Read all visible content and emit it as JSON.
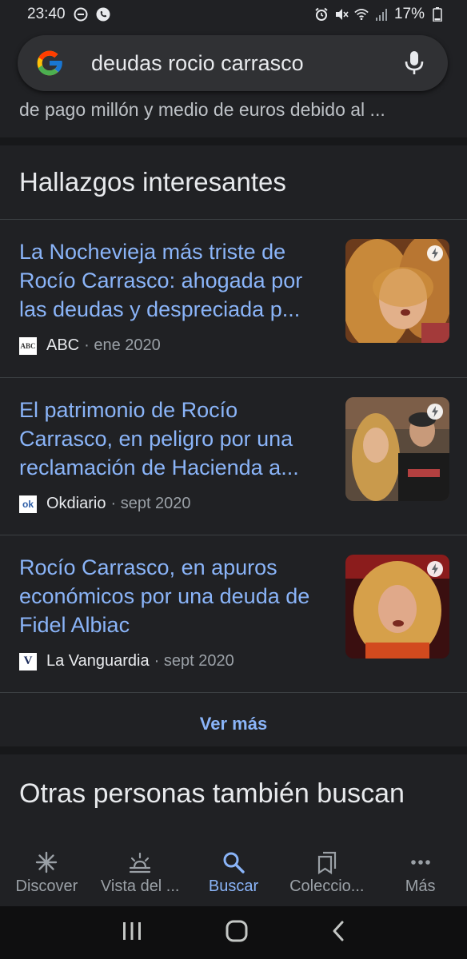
{
  "status_bar": {
    "time": "23:40",
    "battery": "17%"
  },
  "search": {
    "query": "deudas rocio carrasco"
  },
  "snippet": {
    "text": "de pago millón y medio de euros debido al ..."
  },
  "section": {
    "title": "Hallazgos interesantes"
  },
  "articles": [
    {
      "title": "La Nochevieja más triste de Rocío Carrasco: ahogada por las deudas y despreciada p...",
      "source": "ABC",
      "favicon": "ABC",
      "date": "· ene 2020"
    },
    {
      "title": "El patrimonio de Rocío Carrasco, en peligro por una reclamación de Hacienda a...",
      "source": "Okdiario",
      "favicon": "ok",
      "date": "· sept 2020"
    },
    {
      "title": "Rocío Carrasco, en apuros económicos por una deuda de Fidel Albiac",
      "source": "La Vanguardia",
      "favicon": "V",
      "date": "· sept 2020"
    }
  ],
  "more": {
    "label": "Ver más"
  },
  "related": {
    "title": "Otras personas también buscan"
  },
  "bottom_nav": [
    {
      "label": "Discover",
      "icon": "asterisk-icon"
    },
    {
      "label": "Vista del ...",
      "icon": "sunrise-icon"
    },
    {
      "label": "Buscar",
      "icon": "search-icon"
    },
    {
      "label": "Coleccio...",
      "icon": "collections-icon"
    },
    {
      "label": "Más",
      "icon": "more-dots-icon"
    }
  ],
  "colors": {
    "background": "#202124",
    "link": "#8ab4f8",
    "muted": "#9aa0a6",
    "accent_active": "#8ab4f8"
  }
}
